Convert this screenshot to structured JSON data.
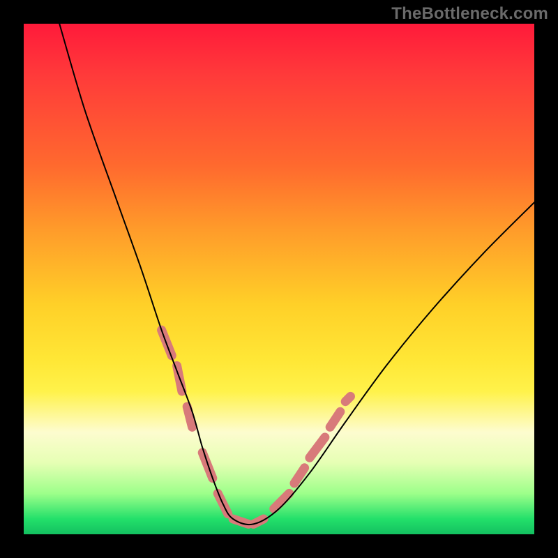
{
  "watermark": "TheBottleneck.com",
  "chart_data": {
    "type": "line",
    "title": "",
    "xlabel": "",
    "ylabel": "",
    "xlim": [
      0,
      100
    ],
    "ylim": [
      0,
      100
    ],
    "gradient_stops": [
      {
        "pos": 0,
        "color": "#ff1a3a"
      },
      {
        "pos": 10,
        "color": "#ff3a3a"
      },
      {
        "pos": 28,
        "color": "#ff6a2e"
      },
      {
        "pos": 40,
        "color": "#ff9a2a"
      },
      {
        "pos": 55,
        "color": "#ffd028"
      },
      {
        "pos": 66,
        "color": "#ffe736"
      },
      {
        "pos": 72,
        "color": "#fff24a"
      },
      {
        "pos": 80,
        "color": "#fdfccf"
      },
      {
        "pos": 86,
        "color": "#e6ffb4"
      },
      {
        "pos": 92,
        "color": "#9dff8a"
      },
      {
        "pos": 97,
        "color": "#23e06a"
      },
      {
        "pos": 100,
        "color": "#13c060"
      }
    ],
    "series": [
      {
        "name": "bottleneck-curve",
        "color": "#000000",
        "x": [
          7,
          12,
          18,
          23,
          27,
          30,
          33,
          35,
          37,
          39,
          41,
          45,
          50,
          56,
          63,
          71,
          80,
          90,
          100
        ],
        "y": [
          100,
          83,
          66,
          52,
          40,
          32,
          24,
          17,
          11,
          6,
          3,
          2,
          5,
          12,
          22,
          33,
          44,
          55,
          65
        ]
      }
    ],
    "markers": {
      "name": "highlight-segments",
      "color": "#d87a7a",
      "stroke_width_px": 13,
      "segments": [
        {
          "x_start": 27,
          "y_start": 40,
          "x_end": 29,
          "y_end": 35
        },
        {
          "x_start": 30,
          "y_start": 33,
          "x_end": 31,
          "y_end": 28
        },
        {
          "x_start": 32,
          "y_start": 25,
          "x_end": 33,
          "y_end": 21
        },
        {
          "x_start": 35,
          "y_start": 16,
          "x_end": 37,
          "y_end": 11
        },
        {
          "x_start": 38,
          "y_start": 8,
          "x_end": 40,
          "y_end": 4
        },
        {
          "x_start": 41,
          "y_start": 3,
          "x_end": 44,
          "y_end": 2
        },
        {
          "x_start": 45,
          "y_start": 2,
          "x_end": 47,
          "y_end": 3
        },
        {
          "x_start": 49,
          "y_start": 5,
          "x_end": 52,
          "y_end": 8
        },
        {
          "x_start": 53,
          "y_start": 10,
          "x_end": 55,
          "y_end": 13
        },
        {
          "x_start": 56,
          "y_start": 15,
          "x_end": 59,
          "y_end": 19
        },
        {
          "x_start": 60,
          "y_start": 21,
          "x_end": 62,
          "y_end": 24
        },
        {
          "x_start": 63,
          "y_start": 26,
          "x_end": 64,
          "y_end": 27
        }
      ]
    }
  }
}
